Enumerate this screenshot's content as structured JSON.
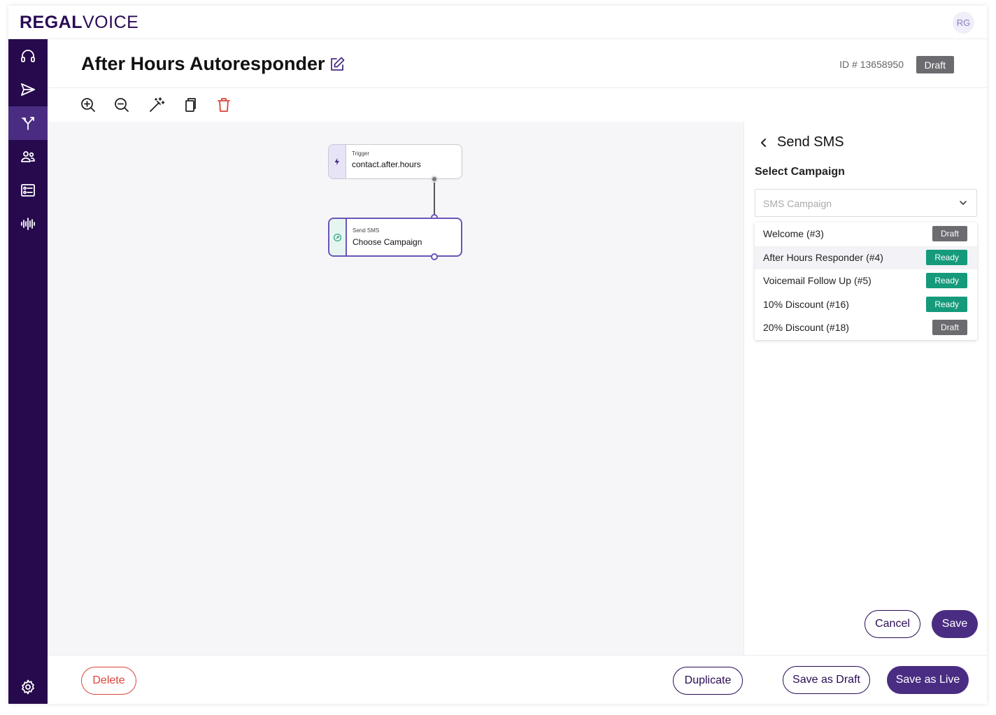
{
  "app": {
    "logo_bold": "REGAL",
    "logo_light": "VOICE",
    "avatar_initials": "RG"
  },
  "sidebar": {
    "items": [
      {
        "icon": "headset-icon"
      },
      {
        "icon": "send-icon"
      },
      {
        "icon": "journey-branch-icon",
        "active": true
      },
      {
        "icon": "contacts-icon"
      },
      {
        "icon": "tasks-list-icon"
      },
      {
        "icon": "audio-wave-icon"
      }
    ],
    "bottom_icon": "settings-icon"
  },
  "header": {
    "title": "After Hours Autoresponder",
    "id_text": "ID # 13658950",
    "status": "Draft"
  },
  "toolbar": {
    "icons": [
      "zoom-in-icon",
      "zoom-out-icon",
      "magic-wand-icon",
      "copy-icon",
      "trash-icon"
    ]
  },
  "canvas": {
    "trigger_node": {
      "small": "Trigger",
      "main": "contact.after.hours"
    },
    "sms_node": {
      "small": "Send SMS",
      "main": "Choose Campaign"
    }
  },
  "panel": {
    "title": "Send SMS",
    "label": "Select Campaign",
    "select_placeholder": "SMS Campaign",
    "options": [
      {
        "label": "Welcome (#3)",
        "status": "Draft"
      },
      {
        "label": "After Hours Responder (#4)",
        "status": "Ready"
      },
      {
        "label": "Voicemail Follow Up (#5)",
        "status": "Ready"
      },
      {
        "label": "10% Discount (#16)",
        "status": "Ready"
      },
      {
        "label": "20% Discount (#18)",
        "status": "Draft"
      }
    ],
    "cancel_label": "Cancel",
    "save_label": "Save"
  },
  "footer": {
    "delete_label": "Delete",
    "duplicate_label": "Duplicate",
    "save_draft_label": "Save as Draft",
    "save_live_label": "Save as Live"
  },
  "colors": {
    "brand": "#2a0a55",
    "sidebar": "#260a4d",
    "primary_button": "#4a2d82",
    "ready": "#159a7b",
    "draft": "#6b6b70",
    "danger": "#d9443a"
  }
}
